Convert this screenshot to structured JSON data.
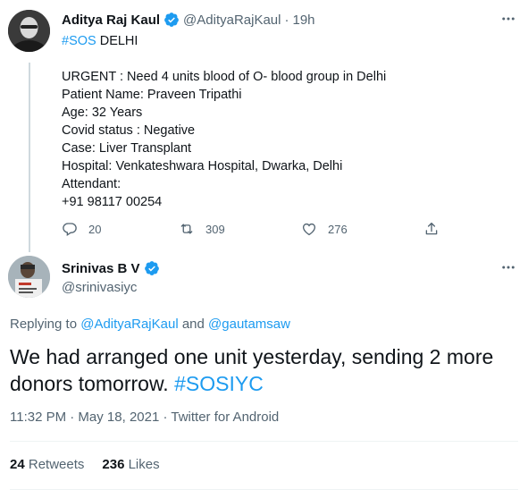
{
  "colors": {
    "link_blue": "#1d9bf0",
    "secondary_text": "#536471",
    "verified_badge": "#1d9bf0"
  },
  "tweet1": {
    "name": "Aditya Raj Kaul",
    "handle": "@AdityaRajKaul",
    "separator": "·",
    "time": "19h",
    "hashtag": "#SOS",
    "first_line_rest": " DELHI",
    "lines": [
      "URGENT : Need 4 units blood of O- blood group in Delhi",
      "Patient Name: Praveen Tripathi",
      "Age: 32 Years",
      "Covid status : Negative",
      "Case: Liver Transplant",
      "Hospital: Venkateshwara Hospital, Dwarka, Delhi",
      "Attendant:",
      "+91 98117 00254"
    ],
    "reply_count": "20",
    "retweet_count": "309",
    "like_count": "276",
    "icons": [
      "reply-icon",
      "retweet-icon",
      "like-icon",
      "share-icon",
      "more-icon",
      "verified-icon"
    ]
  },
  "tweet2": {
    "name": "Srinivas B V",
    "handle": "@srinivasiyc",
    "replying_prefix": "Replying to ",
    "mention1": "@AdityaRajKaul",
    "replying_and": " and ",
    "mention2": "@gautamsaw",
    "body_text": "We had arranged one unit yesterday, sending 2 more donors tomorrow. ",
    "body_hashtag": "#SOSIYC",
    "meta": "11:32 PM · May 18, 2021 · Twitter for Android",
    "retweets_count": "24",
    "retweets_label": "Retweets",
    "likes_count": "236",
    "likes_label": "Likes"
  }
}
